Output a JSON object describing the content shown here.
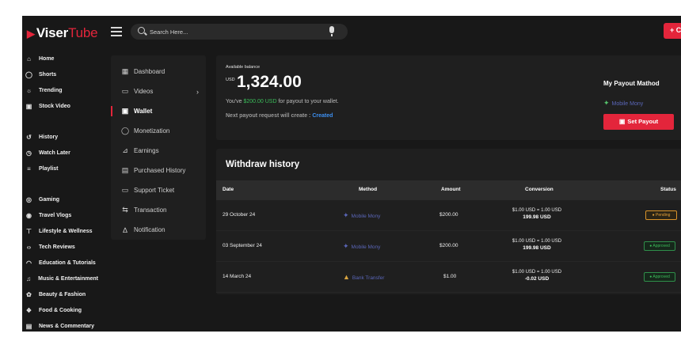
{
  "brand": {
    "prefix": "Viser",
    "suffix": "Tube"
  },
  "search": {
    "placeholder": "Search Here..."
  },
  "header": {
    "create_label": "+ C"
  },
  "sidebar": {
    "items": [
      {
        "icon": "home-icon",
        "label": "Home"
      },
      {
        "icon": "shorts-icon",
        "label": "Shorts"
      },
      {
        "icon": "trending-icon",
        "label": "Trending"
      },
      {
        "icon": "stock-video-icon",
        "label": "Stock Video"
      },
      {
        "icon": "history-icon",
        "label": "History"
      },
      {
        "icon": "watch-later-icon",
        "label": "Watch Later"
      },
      {
        "icon": "playlist-icon",
        "label": "Playlist"
      },
      {
        "icon": "gaming-icon",
        "label": "Gaming"
      },
      {
        "icon": "travel-icon",
        "label": "Travel Vlogs"
      },
      {
        "icon": "lifestyle-icon",
        "label": "Lifestyle & Wellness"
      },
      {
        "icon": "code-icon",
        "label": "Tech Reviews"
      },
      {
        "icon": "education-icon",
        "label": "Education & Tutorials"
      },
      {
        "icon": "music-icon",
        "label": "Music & Entertainment"
      },
      {
        "icon": "beauty-icon",
        "label": "Beauty & Fashion"
      },
      {
        "icon": "food-icon",
        "label": "Food & Cooking"
      },
      {
        "icon": "news-icon",
        "label": "News & Commentary"
      }
    ]
  },
  "submenu": {
    "items": [
      {
        "icon": "dashboard-icon",
        "label": "Dashboard"
      },
      {
        "icon": "videos-icon",
        "label": "Videos"
      },
      {
        "icon": "wallet-icon",
        "label": "Wallet"
      },
      {
        "icon": "monetization-icon",
        "label": "Monetization"
      },
      {
        "icon": "earnings-icon",
        "label": "Earnings"
      },
      {
        "icon": "purchased-icon",
        "label": "Purchased History"
      },
      {
        "icon": "ticket-icon",
        "label": "Support Ticket"
      },
      {
        "icon": "transaction-icon",
        "label": "Transaction"
      },
      {
        "icon": "bell-icon",
        "label": "Notification"
      }
    ],
    "active": "Wallet"
  },
  "balance": {
    "label": "Available balance",
    "currency": "USD",
    "amount": "1,324.00",
    "note_pre": "You've ",
    "note_amount": "$200.00 USD",
    "note_post": " for payout to your wallet.",
    "next_label": "Next payout request will create : ",
    "next_status": "Created"
  },
  "payout": {
    "title": "My Payout Mathod",
    "method": "Mobile Mony",
    "button": "Set Payout"
  },
  "history": {
    "title": "Withdraw history",
    "columns": [
      "Date",
      "Method",
      "Amount",
      "Conversion",
      "Status"
    ],
    "rows": [
      {
        "date": "29 October 24",
        "method": "Mobile Mony",
        "amount": "$200.00",
        "rate": "$1.00 USD = 1.00 USD",
        "converted": "199.98 USD",
        "status": "Pending"
      },
      {
        "date": "03 September 24",
        "method": "Mobile Mony",
        "amount": "$200.00",
        "rate": "$1.00 USD = 1.00 USD",
        "converted": "199.98 USD",
        "status": "Approved"
      },
      {
        "date": "14 March 24",
        "method": "Bank Transfer",
        "amount": "$1.00",
        "rate": "$1.00 USD = 1.00 USD",
        "converted": "-0.02 USD",
        "status": "Approved"
      }
    ]
  },
  "colors": {
    "accent": "#e3253b",
    "positive": "#3bbd5a",
    "link": "#3d8ff0",
    "pending": "#e6a23a"
  }
}
